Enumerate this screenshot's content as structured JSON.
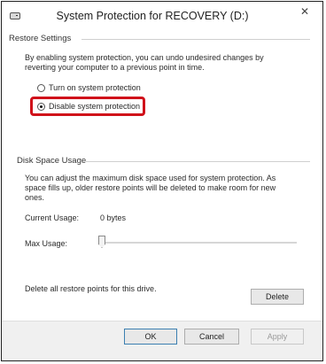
{
  "window": {
    "title": "System Protection for RECOVERY (D:)",
    "close_glyph": "✕"
  },
  "restore_settings": {
    "heading": "Restore Settings",
    "description_line1": "By enabling system protection, you can undo undesired changes by",
    "description_line2": "reverting your computer to a previous point in time.",
    "option_on": "Turn on system protection",
    "option_off": "Disable system protection",
    "selected": "option_off",
    "highlight_color": "#d0101a"
  },
  "disk_space": {
    "heading": "Disk Space Usage",
    "description_line1": "You can adjust the maximum disk space used for system protection. As",
    "description_line2": "space fills up, older restore points will be deleted to make room for new",
    "description_line3": "ones.",
    "current_usage_label": "Current Usage:",
    "current_usage_value": "0 bytes",
    "max_usage_label": "Max Usage:",
    "max_usage_fraction": 0,
    "delete_text": "Delete all restore points for this drive.",
    "delete_button": "Delete"
  },
  "footer": {
    "ok": "OK",
    "cancel": "Cancel",
    "apply": "Apply"
  },
  "icons": {
    "window": "drive-icon",
    "close": "close-icon"
  }
}
